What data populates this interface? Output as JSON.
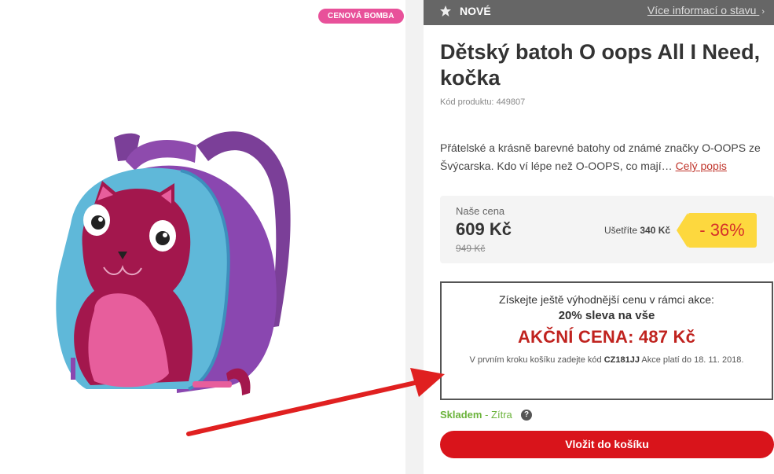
{
  "badge": {
    "label": "CENOVÁ BOMBA",
    "color": "#e8519a"
  },
  "product_image": {
    "description_icon": "backpack-image"
  },
  "status_bar": {
    "icon": "star-icon",
    "label": "NOVÉ",
    "link": "Více informací o stavu",
    "link_icon": "chevron-right-icon"
  },
  "product": {
    "title": "Dětský batoh O oops All I Need, kočka",
    "code_label": "Kód produktu:",
    "code": "449807",
    "description": "Přátelské a krásně barevné batohy od známé značky O-OOPS ze Švýcarska. Kdo ví lépe než O-OOPS, co mají…",
    "description_link": "Celý popis"
  },
  "pricing": {
    "label": "Naše cena",
    "price": "609 Kč",
    "old_price": "949 Kč",
    "save_prefix": "Ušetříte",
    "save_amount": "340 Kč",
    "discount": "- 36%",
    "discount_color": "#fdd83e"
  },
  "promo": {
    "line1": "Získejte ještě výhodnější cenu v rámci akce:",
    "line2": "20% sleva na vše",
    "action_price": "AKČNÍ CENA: 487 Kč",
    "note_prefix": "V prvním kroku košíku zadejte kód",
    "code": "CZ181JJ",
    "note_suffix": "Akce platí do 18. 11. 2018.",
    "accent_color": "#c0231f"
  },
  "stock": {
    "label": "Skladem",
    "separator": " - ",
    "date": "Zítra",
    "help_icon": "question-icon",
    "help_glyph": "?"
  },
  "cart": {
    "label": "Vložit do košíku",
    "color": "#d9141b"
  },
  "annotation": {
    "icon": "red-arrow-icon",
    "color": "#e02020"
  }
}
